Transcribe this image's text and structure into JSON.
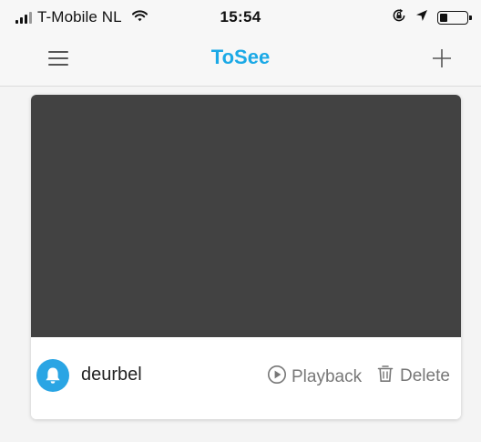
{
  "status_bar": {
    "carrier": "T-Mobile NL",
    "time": "15:54",
    "battery_level": 0.3
  },
  "nav": {
    "title": "ToSee",
    "title_color": "#1ba9e6"
  },
  "device": {
    "name": "deurbel",
    "avatar_color": "#2aa5e4",
    "playback_label": "Playback",
    "delete_label": "Delete"
  },
  "icons": {
    "menu": "hamburger-menu-icon",
    "add": "plus-icon",
    "device": "bell-icon",
    "playback": "play-circle-icon",
    "delete": "trash-icon"
  }
}
